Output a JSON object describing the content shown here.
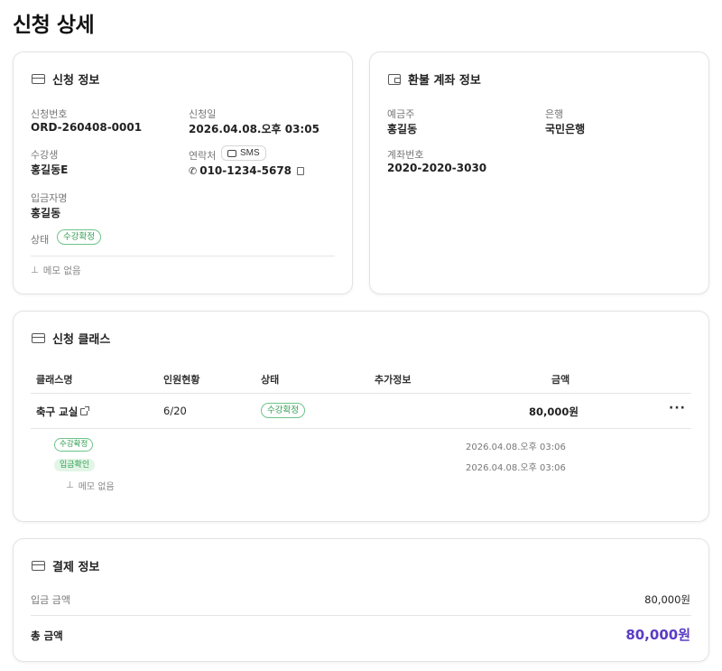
{
  "page": {
    "title": "신청 상세"
  },
  "application_info": {
    "title": "신청 정보",
    "order_no_label": "신청번호",
    "order_no": "ORD-260408-0001",
    "date_label": "신청일",
    "date": "2026.04.08.오후 03:05",
    "student_label": "수강생",
    "student": "홍길동E",
    "contact_label": "연락처",
    "sms_label": "SMS",
    "phone": "010-1234-5678",
    "depositor_label": "입금자명",
    "depositor": "홍길동",
    "status_label": "상태",
    "status": "수강확정",
    "memo": "메모 없음"
  },
  "refund_account": {
    "title": "환불 계좌 정보",
    "holder_label": "예금주",
    "holder": "홍길동",
    "bank_label": "은행",
    "bank": "국민은행",
    "account_label": "계좌번호",
    "account": "2020-2020-3030"
  },
  "classes": {
    "title": "신청 클래스",
    "headers": {
      "name": "클래스명",
      "headcount": "인원현황",
      "status": "상태",
      "extra": "추가정보",
      "amount": "금액"
    },
    "row": {
      "name": "축구 교실",
      "headcount": "6/20",
      "status": "수강확정",
      "extra": "",
      "amount": "80,000원",
      "more": "···"
    },
    "history": [
      {
        "badge": "수강확정",
        "date": "2026.04.08.오후 03:06"
      },
      {
        "badge": "입금확인",
        "date": "2026.04.08.오후 03:06"
      }
    ],
    "memo": "메모 없음"
  },
  "payment": {
    "title": "결제 정보",
    "deposit_label": "입금 금액",
    "deposit": "80,000원",
    "total_label": "총 금액",
    "total": "80,000원",
    "total_color": "#5b3cc4"
  }
}
